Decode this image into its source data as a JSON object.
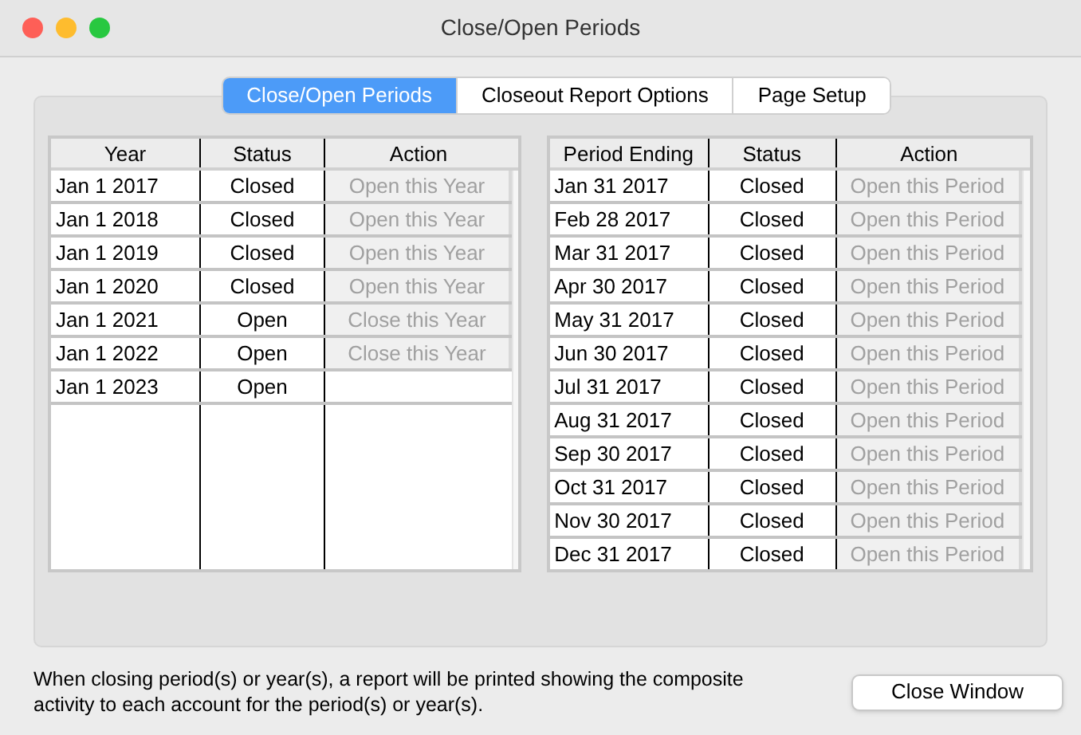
{
  "window": {
    "title": "Close/Open Periods"
  },
  "tabs": [
    {
      "label": "Close/Open Periods",
      "selected": true
    },
    {
      "label": "Closeout Report Options",
      "selected": false
    },
    {
      "label": "Page Setup",
      "selected": false
    }
  ],
  "years_table": {
    "columns": [
      "Year",
      "Status",
      "Action"
    ],
    "rows": [
      {
        "year": "Jan 1 2017",
        "status": "Closed",
        "action": "Open this Year",
        "disabled": true
      },
      {
        "year": "Jan 1 2018",
        "status": "Closed",
        "action": "Open this Year",
        "disabled": true
      },
      {
        "year": "Jan 1 2019",
        "status": "Closed",
        "action": "Open this Year",
        "disabled": true
      },
      {
        "year": "Jan 1 2020",
        "status": "Closed",
        "action": "Open this Year",
        "disabled": true
      },
      {
        "year": "Jan 1 2021",
        "status": "Open",
        "action": "Close this Year",
        "disabled": true
      },
      {
        "year": "Jan 1 2022",
        "status": "Open",
        "action": "Close this Year",
        "disabled": true
      },
      {
        "year": "Jan 1 2023",
        "status": "Open"
      }
    ]
  },
  "periods_table": {
    "columns": [
      "Period Ending",
      "Status",
      "Action"
    ],
    "rows": [
      {
        "year": "Jan 31 2017",
        "status": "Closed",
        "action": "Open this Period",
        "disabled": true
      },
      {
        "year": "Feb 28 2017",
        "status": "Closed",
        "action": "Open this Period",
        "disabled": true
      },
      {
        "year": "Mar 31 2017",
        "status": "Closed",
        "action": "Open this Period",
        "disabled": true
      },
      {
        "year": "Apr 30 2017",
        "status": "Closed",
        "action": "Open this Period",
        "disabled": true
      },
      {
        "year": "May 31 2017",
        "status": "Closed",
        "action": "Open this Period",
        "disabled": true
      },
      {
        "year": "Jun 30 2017",
        "status": "Closed",
        "action": "Open this Period",
        "disabled": true
      },
      {
        "year": "Jul 31 2017",
        "status": "Closed",
        "action": "Open this Period",
        "disabled": true
      },
      {
        "year": "Aug 31 2017",
        "status": "Closed",
        "action": "Open this Period",
        "disabled": true
      },
      {
        "year": "Sep 30 2017",
        "status": "Closed",
        "action": "Open this Period",
        "disabled": true
      },
      {
        "year": "Oct 31 2017",
        "status": "Closed",
        "action": "Open this Period",
        "disabled": true
      },
      {
        "year": "Nov 30 2017",
        "status": "Closed",
        "action": "Open this Period",
        "disabled": true
      },
      {
        "year": "Dec 31 2017",
        "status": "Closed",
        "action": "Open this Period",
        "disabled": true
      }
    ]
  },
  "footer": {
    "note": "When closing period(s) or year(s), a report will be printed showing the composite activity to each account for the period(s) or year(s).",
    "button": "Close Window"
  }
}
